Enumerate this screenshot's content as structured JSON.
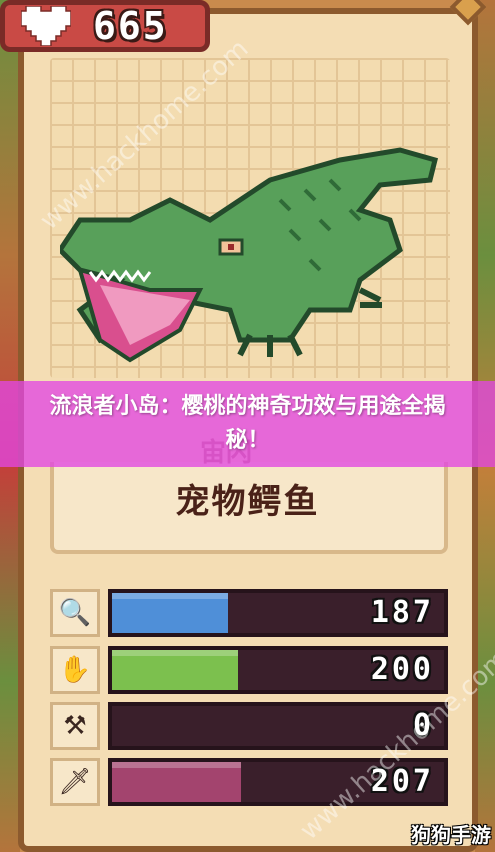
{
  "health": {
    "icon": "heart-icon",
    "value": "665"
  },
  "banner": {
    "text": "流浪者小岛：樱桃的神奇功效与用途全揭秘！"
  },
  "creature": {
    "name": "宠物鳄鱼",
    "partial_title": "宙闪"
  },
  "stats": [
    {
      "icon": "magnifier-icon",
      "value": "187",
      "fill": 0.35,
      "color": "#4f8fd8"
    },
    {
      "icon": "hand-icon",
      "value": "200",
      "fill": 0.38,
      "color": "#7cc04e"
    },
    {
      "icon": "hammer-icon",
      "value": "0",
      "fill": 0,
      "color": "#6aa04e"
    },
    {
      "icon": "sword-icon",
      "value": "207",
      "fill": 0.39,
      "color": "#a3446e"
    }
  ],
  "watermark": "www.hackhome.com",
  "logo": "狗狗手游"
}
